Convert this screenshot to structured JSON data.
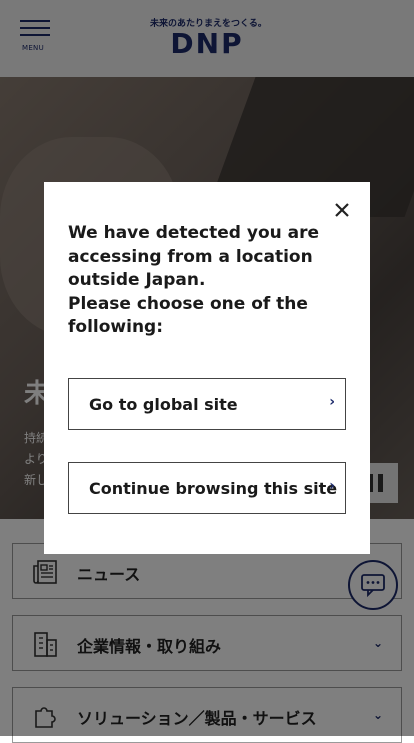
{
  "header": {
    "menu_label": "MENU",
    "logo_tagline": "未来のあたりまえをつくる。",
    "logo_text": "DNP"
  },
  "hero": {
    "heading": "未",
    "text": "持続\nより\n新し"
  },
  "nav": {
    "items": [
      {
        "label": "ニュース"
      },
      {
        "label": "企業情報・取り組み"
      },
      {
        "label": "ソリューション／製品・サービス"
      }
    ]
  },
  "modal": {
    "message": "We have detected you are accessing from a location outside Japan.\nPlease choose one of the following:",
    "global_site_label": "Go to global site",
    "continue_label": "Continue browsing this site"
  },
  "colors": {
    "brand": "#1c2a6b",
    "overlay": "rgba(0,0,0,0.5)"
  }
}
